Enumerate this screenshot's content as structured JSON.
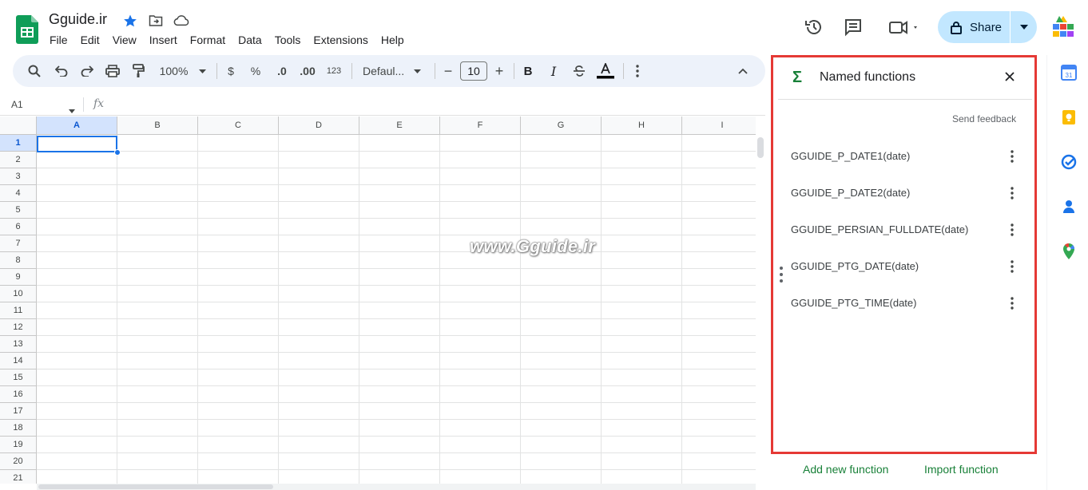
{
  "doc": {
    "title": "Gguide.ir"
  },
  "menu": [
    "File",
    "Edit",
    "View",
    "Insert",
    "Format",
    "Data",
    "Tools",
    "Extensions",
    "Help"
  ],
  "header": {
    "share_label": "Share"
  },
  "toolbar": {
    "zoom": "100%",
    "currency": "$",
    "percent": "%",
    "dec_decrease": ".0",
    "dec_increase": ".00",
    "number_format": "123",
    "font": "Defaul...",
    "font_size": "10",
    "minus": "−",
    "plus": "+",
    "bold": "B",
    "italic": "I"
  },
  "formula_bar": {
    "cell_ref": "A1",
    "fx": "fx"
  },
  "grid": {
    "columns": [
      "A",
      "B",
      "C",
      "D",
      "E",
      "F",
      "G",
      "H",
      "I"
    ],
    "rows": [
      "1",
      "2",
      "3",
      "4",
      "5",
      "6",
      "7",
      "8",
      "9",
      "10",
      "11",
      "12",
      "13",
      "14",
      "15",
      "16",
      "17",
      "18",
      "19",
      "20",
      "21"
    ]
  },
  "watermark": "www.Gguide.ir",
  "panel": {
    "title": "Named functions",
    "send_feedback": "Send feedback",
    "functions": [
      "GGUIDE_P_DATE1(date)",
      "GGUIDE_P_DATE2(date)",
      "GGUIDE_PERSIAN_FULLDATE(date)",
      "GGUIDE_PTG_DATE(date)",
      "GGUIDE_PTG_TIME(date)"
    ],
    "add_new": "Add new function",
    "import": "Import function"
  },
  "colors": {
    "accent": "#1a73e8",
    "share_bg": "#c2e7ff",
    "panel_border": "#e53935",
    "green": "#188038",
    "toolbar_bg": "#edf2fa"
  }
}
